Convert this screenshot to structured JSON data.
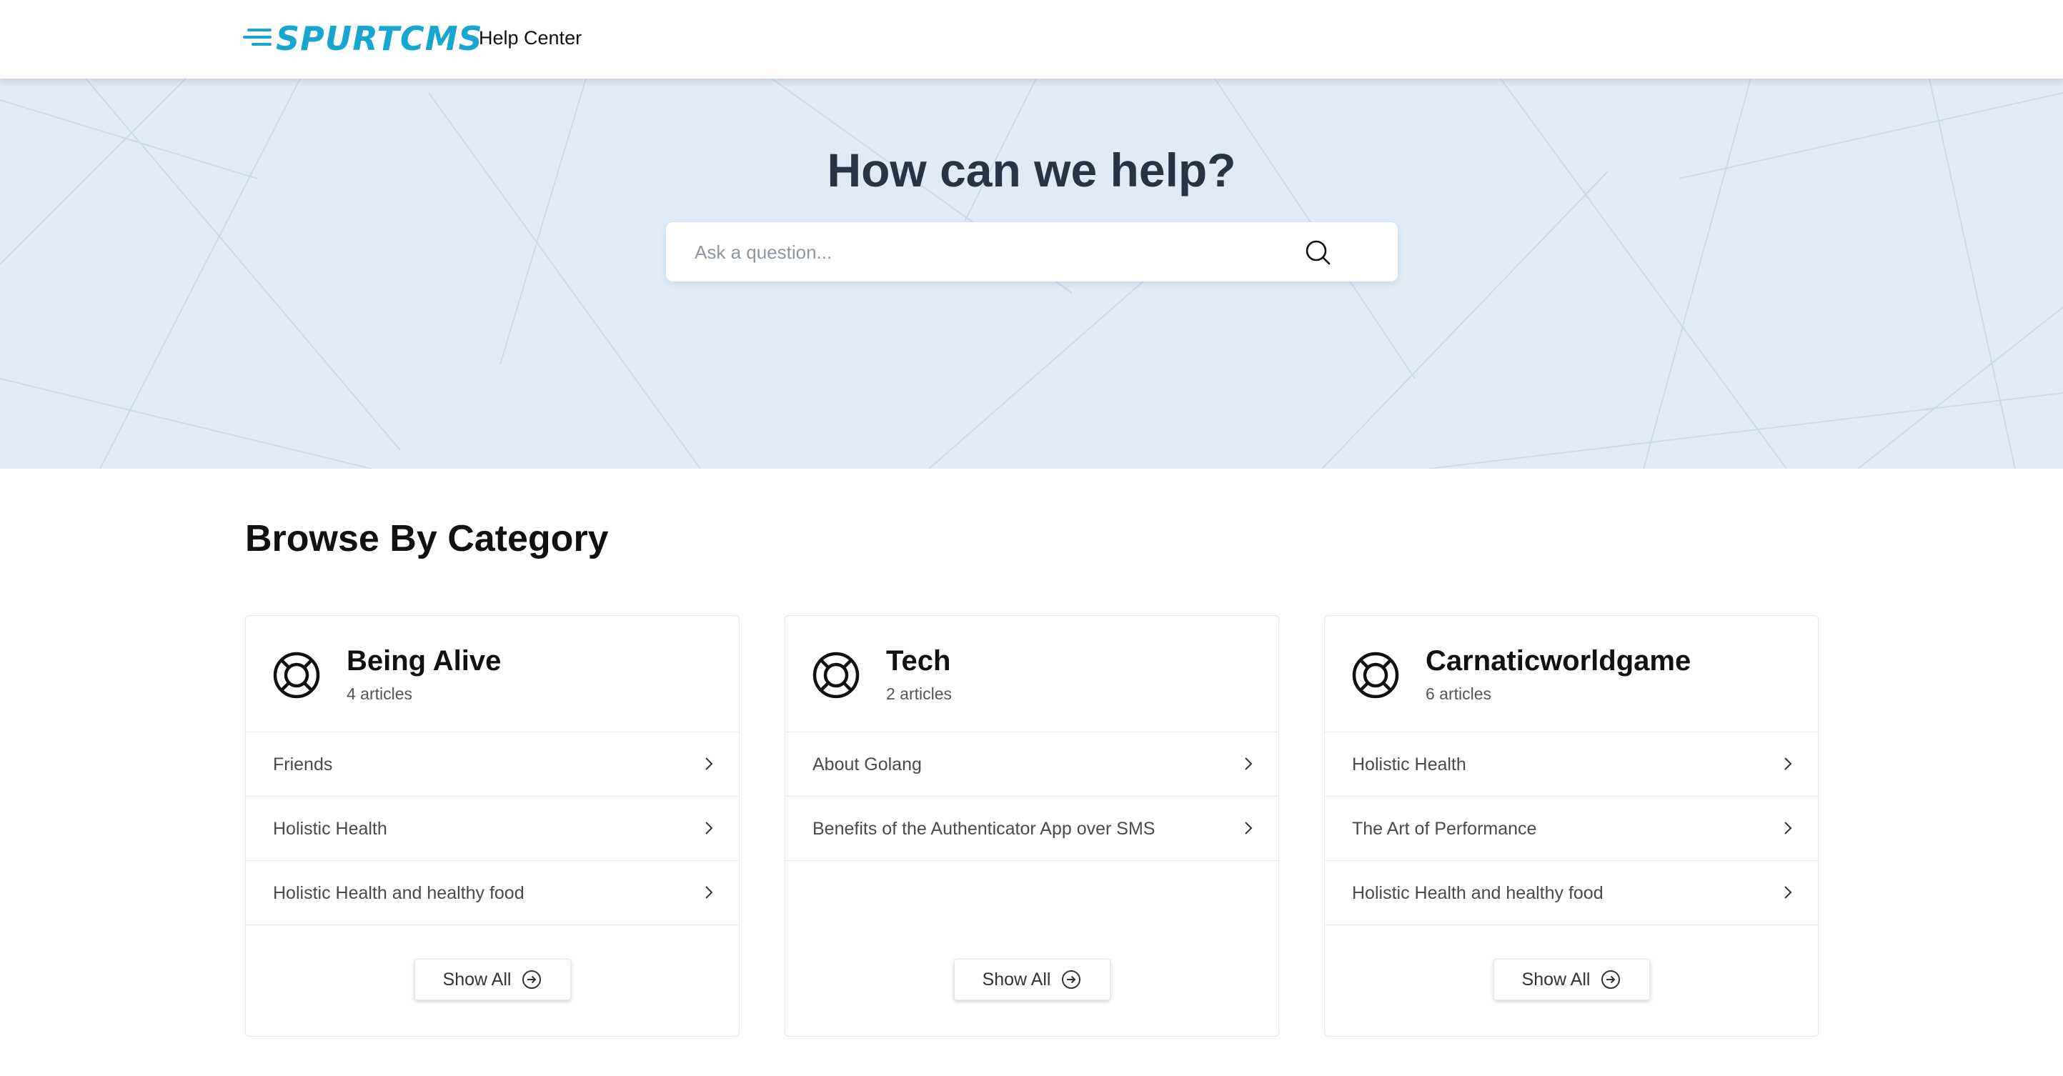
{
  "header": {
    "logo_text": "SPURTCMS",
    "title": "Help Center"
  },
  "hero": {
    "title": "How can we help?",
    "search_placeholder": "Ask a question..."
  },
  "section": {
    "title": "Browse By Category"
  },
  "colors": {
    "brand": "#16a6cf",
    "hero_bg": "#dfebf6",
    "hero_title": "#263445"
  },
  "categories": [
    {
      "title": "Being Alive",
      "count": "4 articles",
      "icon": "lifebuoy-icon",
      "items": [
        "Friends",
        "Holistic Health",
        "Holistic Health and healthy food"
      ],
      "button": "Show All"
    },
    {
      "title": "Tech",
      "count": "2 articles",
      "icon": "lifebuoy-icon",
      "items": [
        "About Golang",
        "Benefits of the Authenticator App over SMS"
      ],
      "button": "Show All"
    },
    {
      "title": "Carnaticworldgame",
      "count": "6 articles",
      "icon": "lifebuoy-icon",
      "items": [
        "Holistic Health",
        "The Art of Performance",
        "Holistic Health and healthy food"
      ],
      "button": "Show All"
    }
  ]
}
